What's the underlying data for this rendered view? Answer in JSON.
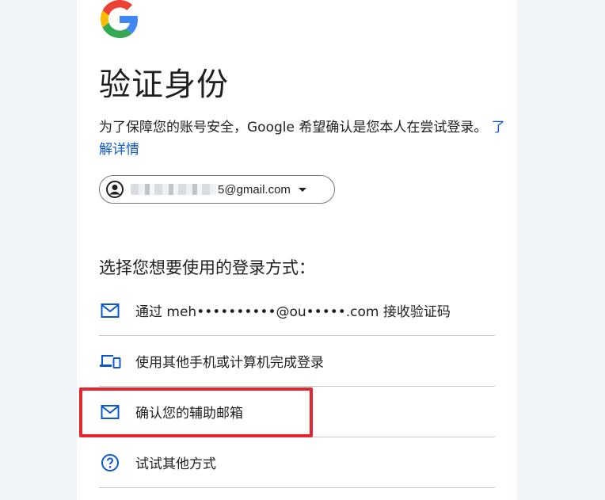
{
  "brand": {
    "logo_icon": "google-g-logo"
  },
  "header": {
    "title": "验证身份"
  },
  "description": {
    "text": "为了保障您的账号安全，Google 希望确认是您本人在尝试登录。",
    "link": "了解详情"
  },
  "account": {
    "email_suffix": "5@gmail.com",
    "icon": "account-circle-icon"
  },
  "section": {
    "label": "选择您想要使用的登录方式："
  },
  "options": [
    {
      "label": "通过 meh••••••••••@ou•••••.com 接收验证码",
      "icon": "mail-icon"
    },
    {
      "label": "使用其他手机或计算机完成登录",
      "icon": "devices-icon"
    },
    {
      "label": "确认您的辅助邮箱",
      "icon": "mail-icon"
    },
    {
      "label": "试试其他方式",
      "icon": "help-circle-icon"
    }
  ],
  "colors": {
    "accent": "#0b57d0",
    "annotation": "#e3262f",
    "text": "#1f1f1f"
  }
}
